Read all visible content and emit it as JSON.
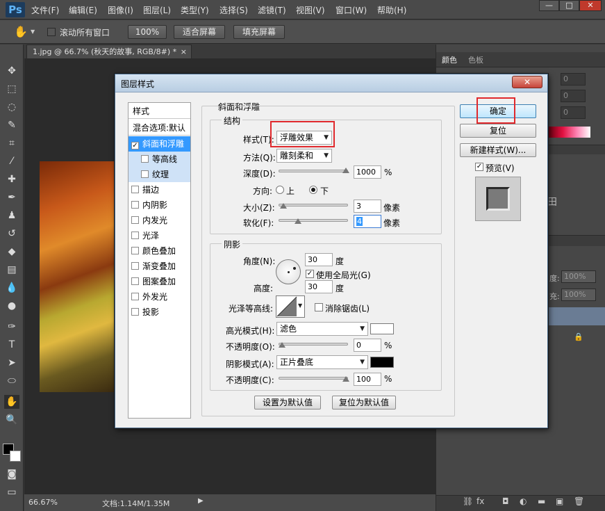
{
  "app": {
    "logo": "Ps"
  },
  "menu": [
    "文件(F)",
    "编辑(E)",
    "图像(I)",
    "图层(L)",
    "类型(Y)",
    "选择(S)",
    "滤镜(T)",
    "视图(V)",
    "窗口(W)",
    "帮助(H)"
  ],
  "window_controls": [
    "—",
    "□",
    "✕"
  ],
  "options_bar": {
    "scroll_all": "滚动所有窗口",
    "zoom_100": "100%",
    "fit_screen": "适合屏幕",
    "fill_screen": "填充屏幕"
  },
  "document": {
    "tab": "1.jpg @ 66.7% (秋天的故事, RGB/8#) *",
    "close": "×"
  },
  "statusbar": {
    "zoom": "66.67%",
    "doc_size": "文档:1.14M/1.35M"
  },
  "panels": {
    "color_tab": "颜色",
    "swatches_tab": "色板",
    "channel_values": [
      "0",
      "0",
      "0"
    ],
    "opacity_label": "度:",
    "opacity_value": "100%",
    "fill_label": "充:",
    "fill_value": "100%"
  },
  "dialog": {
    "title": "图层样式",
    "close": "✕",
    "styles_header": "样式",
    "blend_default": "混合选项:默认",
    "style_items": [
      {
        "label": "斜面和浮雕",
        "checked": true,
        "selected": true,
        "sub": false
      },
      {
        "label": "等高线",
        "checked": false,
        "selected": false,
        "sub": true
      },
      {
        "label": "纹理",
        "checked": false,
        "selected": false,
        "sub": true
      },
      {
        "label": "描边",
        "checked": false,
        "selected": false,
        "sub": false
      },
      {
        "label": "内阴影",
        "checked": false,
        "selected": false,
        "sub": false
      },
      {
        "label": "内发光",
        "checked": false,
        "selected": false,
        "sub": false
      },
      {
        "label": "光泽",
        "checked": false,
        "selected": false,
        "sub": false
      },
      {
        "label": "颜色叠加",
        "checked": false,
        "selected": false,
        "sub": false
      },
      {
        "label": "渐变叠加",
        "checked": false,
        "selected": false,
        "sub": false
      },
      {
        "label": "图案叠加",
        "checked": false,
        "selected": false,
        "sub": false
      },
      {
        "label": "外发光",
        "checked": false,
        "selected": false,
        "sub": false
      },
      {
        "label": "投影",
        "checked": false,
        "selected": false,
        "sub": false
      }
    ],
    "bevel": {
      "section": "斜面和浮雕",
      "structure": "结构",
      "style_label": "样式(T):",
      "style_value": "浮雕效果",
      "technique_label": "方法(Q):",
      "technique_value": "雕刻柔和",
      "depth_label": "深度(D):",
      "depth_value": "1000",
      "depth_unit": "%",
      "depth_level": 1.0,
      "direction_label": "方向:",
      "dir_up": "上",
      "dir_down": "下",
      "direction_selected": "下",
      "size_label": "大小(Z):",
      "size_value": "3",
      "size_unit": "像素",
      "size_level": 0.02,
      "soften_label": "软化(F):",
      "soften_value": "4",
      "soften_unit": "像素",
      "soften_level": 0.25
    },
    "shading": {
      "section": "阴影",
      "angle_label": "角度(N):",
      "angle_value": "30",
      "angle_unit": "度",
      "global_light": "使用全局光(G)",
      "global_light_checked": true,
      "altitude_label": "高度:",
      "altitude_value": "30",
      "altitude_unit": "度",
      "gloss_label": "光泽等高线:",
      "anti_alias": "消除锯齿(L)",
      "anti_alias_checked": false,
      "highlight_mode_label": "高光模式(H):",
      "highlight_mode": "滤色",
      "highlight_color": "#ffffff",
      "highlight_opacity_label": "不透明度(O):",
      "highlight_opacity": "0",
      "highlight_opacity_level": 0.0,
      "shadow_mode_label": "阴影模式(A):",
      "shadow_mode": "正片叠底",
      "shadow_color": "#000000",
      "shadow_opacity_label": "不透明度(C):",
      "shadow_opacity": "100",
      "shadow_opacity_level": 1.0,
      "percent": "%"
    },
    "set_default": "设置为默认值",
    "reset_default": "复位为默认值",
    "ok": "确定",
    "reset": "复位",
    "new_style": "新建样式(W)...",
    "preview": "预览(V)",
    "preview_checked": true
  }
}
